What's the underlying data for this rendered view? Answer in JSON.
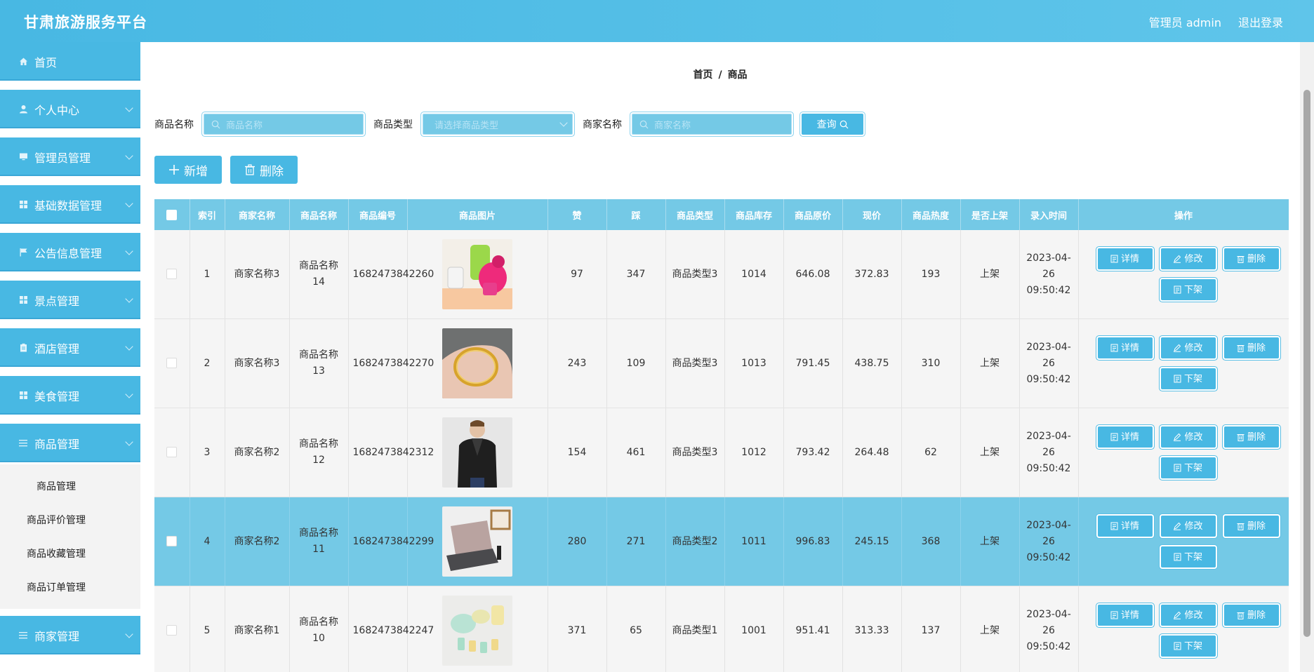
{
  "header": {
    "title": "甘肃旅游服务平台",
    "user": "管理员 admin",
    "logout": "退出登录"
  },
  "sidebar": {
    "items": [
      {
        "label": "首页",
        "icon": "home-icon"
      },
      {
        "label": "个人中心",
        "icon": "user-icon"
      },
      {
        "label": "管理员管理",
        "icon": "monitor-icon"
      },
      {
        "label": "基础数据管理",
        "icon": "grid-icon"
      },
      {
        "label": "公告信息管理",
        "icon": "flag-icon"
      },
      {
        "label": "景点管理",
        "icon": "grid-icon"
      },
      {
        "label": "酒店管理",
        "icon": "clipboard-icon"
      },
      {
        "label": "美食管理",
        "icon": "grid-icon"
      },
      {
        "label": "商品管理",
        "icon": "list-icon"
      },
      {
        "label": "商家管理",
        "icon": "list-icon"
      }
    ],
    "sub_items": [
      "商品管理",
      "商品评价管理",
      "商品收藏管理",
      "商品订单管理"
    ]
  },
  "breadcrumb": {
    "home": "首页",
    "sep": "/",
    "current": "商品"
  },
  "search": {
    "name_label": "商品名称",
    "name_placeholder": "商品名称",
    "type_label": "商品类型",
    "type_placeholder": "请选择商品类型",
    "merchant_label": "商家名称",
    "merchant_placeholder": "商家名称",
    "query": "查询"
  },
  "actions": {
    "add": "新增",
    "delete": "删除"
  },
  "table": {
    "headers": [
      "索引",
      "商家名称",
      "商品名称",
      "商品编号",
      "商品图片",
      "赞",
      "踩",
      "商品类型",
      "商品库存",
      "商品原价",
      "现价",
      "商品热度",
      "是否上架",
      "录入时间",
      "操作"
    ],
    "buttons": {
      "detail": "详情",
      "edit": "修改",
      "delete": "删除",
      "offshelf": "下架"
    },
    "rows": [
      {
        "index": "1",
        "merchant": "商家名称3",
        "name": "商品名称14",
        "code": "1682473842260",
        "likes": "97",
        "dislikes": "347",
        "type": "商品类型3",
        "stock": "1014",
        "orig": "646.08",
        "now": "372.83",
        "heat": "193",
        "onshelf": "上架",
        "time": "2023-04-26 09:50:42",
        "img": "cups"
      },
      {
        "index": "2",
        "merchant": "商家名称3",
        "name": "商品名称13",
        "code": "1682473842270",
        "likes": "243",
        "dislikes": "109",
        "type": "商品类型3",
        "stock": "1013",
        "orig": "791.45",
        "now": "438.75",
        "heat": "310",
        "onshelf": "上架",
        "time": "2023-04-26 09:50:42",
        "img": "bracelet"
      },
      {
        "index": "3",
        "merchant": "商家名称2",
        "name": "商品名称12",
        "code": "1682473842312",
        "likes": "154",
        "dislikes": "461",
        "type": "商品类型3",
        "stock": "1012",
        "orig": "793.42",
        "now": "264.48",
        "heat": "62",
        "onshelf": "上架",
        "time": "2023-04-26 09:50:42",
        "img": "jacket"
      },
      {
        "index": "4",
        "merchant": "商家名称2",
        "name": "商品名称11",
        "code": "1682473842299",
        "likes": "280",
        "dislikes": "271",
        "type": "商品类型2",
        "stock": "1011",
        "orig": "996.83",
        "now": "245.15",
        "heat": "368",
        "onshelf": "上架",
        "time": "2023-04-26 09:50:42",
        "img": "laptop"
      },
      {
        "index": "5",
        "merchant": "商家名称1",
        "name": "商品名称10",
        "code": "1682473842247",
        "likes": "371",
        "dislikes": "65",
        "type": "商品类型1",
        "stock": "1001",
        "orig": "951.41",
        "now": "313.33",
        "heat": "137",
        "onshelf": "上架",
        "time": "2023-04-26 09:50:42",
        "img": "bowls"
      }
    ]
  },
  "colors": {
    "primary": "#48b8e3",
    "header_row": "#74c9e6",
    "row_bg": "#f5f5f5"
  }
}
